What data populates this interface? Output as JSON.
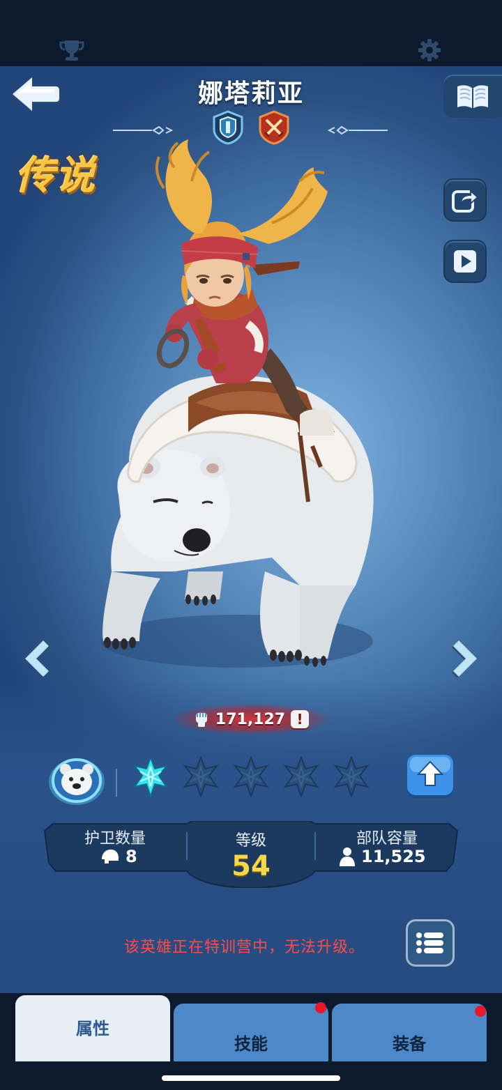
{
  "hero": {
    "name": "娜塔莉亚",
    "rarity": "传说",
    "power": "171,127",
    "power_warning": "!"
  },
  "icons": {
    "top_left": "trophy-icon",
    "top_right": "gear-icon",
    "back": "back-arrow-icon",
    "book": "book-icon",
    "share": "share-icon",
    "play": "play-icon",
    "badge_defense": "shield-badge-icon",
    "badge_attack": "crossed-swords-badge-icon",
    "pet": "polar-bear-icon",
    "upgrade": "up-arrow-icon",
    "list": "list-icon"
  },
  "stars": {
    "filled": 1,
    "total": 5
  },
  "stats": {
    "guard": {
      "label": "护卫数量",
      "value": "8"
    },
    "level": {
      "label": "等级",
      "value": "54"
    },
    "capacity": {
      "label": "部队容量",
      "value": "11,525"
    }
  },
  "message": "该英雄正在特训营中，无法升级。",
  "tabs": [
    {
      "label": "属性",
      "active": true,
      "badge": false
    },
    {
      "label": "技能",
      "active": false,
      "badge": true
    },
    {
      "label": "装备",
      "active": false,
      "badge": true
    }
  ],
  "colors": {
    "accent_gold": "#f7d84a",
    "warning_red": "#ff4a48",
    "star_active": "#37e3ea",
    "tab_inactive": "#4f88c8"
  }
}
